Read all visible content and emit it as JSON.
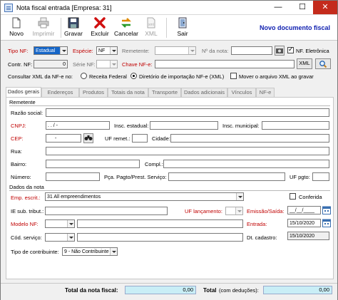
{
  "window": {
    "title": "Nota fiscal entrada [Empresa: 31]",
    "minimize": "—",
    "maximize": "☐",
    "close": "✕"
  },
  "toolbar": {
    "novo": "Novo",
    "imprimir": "Imprimir",
    "gravar": "Gravar",
    "excluir": "Excluir",
    "cancelar": "Cancelar",
    "xml": "XML",
    "sair": "Sair",
    "doc_title": "Novo documento fiscal"
  },
  "header": {
    "tipo_nf_label": "Tipo NF:",
    "tipo_nf_value": "Estadual",
    "especie_label": "Espécie:",
    "especie_value": "NF",
    "remetente_label": "Remetente:",
    "remetente_value": "",
    "nr_nota_label": "Nº da nota:",
    "nr_nota_value": "",
    "nf_eletronica_label": "NF. Eletrônica",
    "contr_nf_label": "Contr. NF:",
    "contr_nf_value": "0",
    "serie_nf_label": "Série NF:",
    "serie_nf_value": "",
    "chave_label": "Chave NF-e:",
    "chave_value": "",
    "xml_button": "XML",
    "consultar_label": "Consultar XML da NF-e no:",
    "receita_label": "Receita Federal",
    "diretorio_label": "Diretório de importação NF-e (XML)",
    "mover_label": "Mover o arquivo XML ao gravar"
  },
  "tabs": [
    "Dados gerais",
    "Endereços",
    "Produtos",
    "Totais da nota",
    "Transporte",
    "Dados adicionais",
    "Vínculos",
    "NF-e"
  ],
  "remetente": {
    "section": "Remetente",
    "razao_social": "Razão social:",
    "cnpj": "CNPJ:",
    "cnpj_value": ".   .   /   -",
    "insc_estadual": "Insc. estadual:",
    "insc_municipal": "Insc. municipal:",
    "cep": "CEP:",
    "cep_value": "-",
    "uf_remet": "UF remet.:",
    "cidade": "Cidade:",
    "rua": "Rua:",
    "bairro": "Bairro:",
    "compl": "Compl.:",
    "numero": "Número:",
    "pca_pagto": "Pça. Pagto/Prest. Serviço:",
    "uf_pgto": "UF pgto:"
  },
  "dados_nota": {
    "section": "Dados da nota",
    "emp_escrit": "Emp. escrit.:",
    "emp_escrit_value": "31  All empreendimentos",
    "conferida": "Conferida",
    "ie_sub": "IE sub. tribut.:",
    "uf_lancamento": "UF lançamento:",
    "emissao_saida": "Emissão/Saída:",
    "emissao_value": "__/__/____",
    "modelo_nf": "Modelo NF:",
    "entrada": "Entrada:",
    "entrada_value": "15/10/2020",
    "cod_servico": "Cód. serviço:",
    "dt_cadastro": "Dt. cadastro:",
    "dt_cadastro_value": "15/10/2020",
    "tipo_contrib": "Tipo de contribuinte:",
    "tipo_contrib_value": "9 - Não Contribuinte"
  },
  "footer": {
    "total_nota_label": "Total da nota fiscal:",
    "total_nota_value": "0,00",
    "total_label": "Total",
    "com_deducoes": "(com deduções):",
    "total_value": "0,00"
  },
  "colors": {
    "required_label": "#c00000",
    "doc_title": "#1020b0",
    "totals_field": "#c9eef6",
    "selected_field": "#1566c8"
  }
}
